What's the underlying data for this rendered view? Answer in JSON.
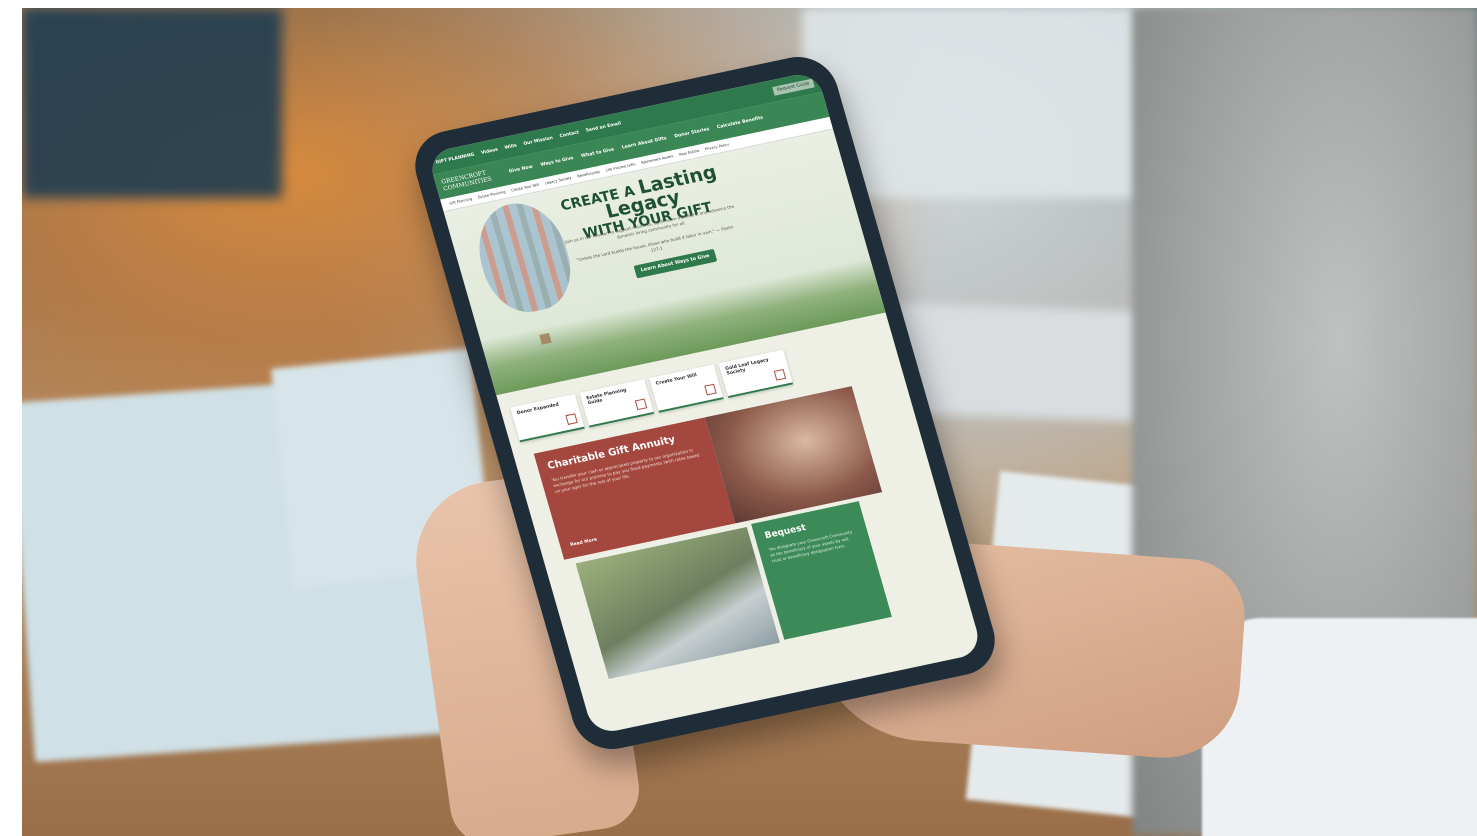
{
  "website": {
    "topbar": {
      "brand": "GIFT PLANNING",
      "links": [
        "Videos",
        "Wills",
        "Our Mission",
        "Contact",
        "Send an Email"
      ],
      "cta": "Request Guide"
    },
    "logo": "GREENCROFT COMMUNITIES",
    "nav": [
      "Give Now",
      "Ways to Give",
      "What to Give",
      "Learn About Gifts",
      "Donor Stories",
      "Calculate Benefits"
    ],
    "subnav": [
      "Gift Planning",
      "Estate Planning",
      "Create Your Will",
      "Legacy Society",
      "Beneficiaries",
      "Life Income Gifts",
      "Retirement Assets",
      "Real Estate",
      "Privacy Policy"
    ],
    "hero": {
      "title_line1_prefix": "CREATE A",
      "title_line1_big": "Lasting Legacy",
      "title_line2": "WITH YOUR GIFT",
      "intro": "Join us in our mission to support residents, uplift team members, and advance the dynamic living community for all.",
      "quote": "\"Unless the Lord builds the house, those who build it labor in vain.\" — Psalm 127:1",
      "button": "Learn About Ways to Give"
    },
    "cards": [
      "Donor Expanded",
      "Estate Planning Guide",
      "Create Your Will",
      "Gold Leaf Legacy Society"
    ],
    "charitable_gift_annuity": {
      "title": "Charitable Gift Annuity",
      "body": "You transfer your cash or appreciated property to our organization in exchange for our promise to pay you fixed payments (with rates based on your age) for the rest of your life.",
      "link": "Read More"
    },
    "bequest": {
      "title": "Bequest",
      "body": "You designate your Greencroft Community as the beneficiary of your assets by will, trust or beneficiary designation form."
    }
  },
  "colors": {
    "brand_green": "#2f7a4c",
    "nav_green": "#3b8655",
    "annuity_red": "#a4483f",
    "bequest_green": "#3d8a59"
  }
}
